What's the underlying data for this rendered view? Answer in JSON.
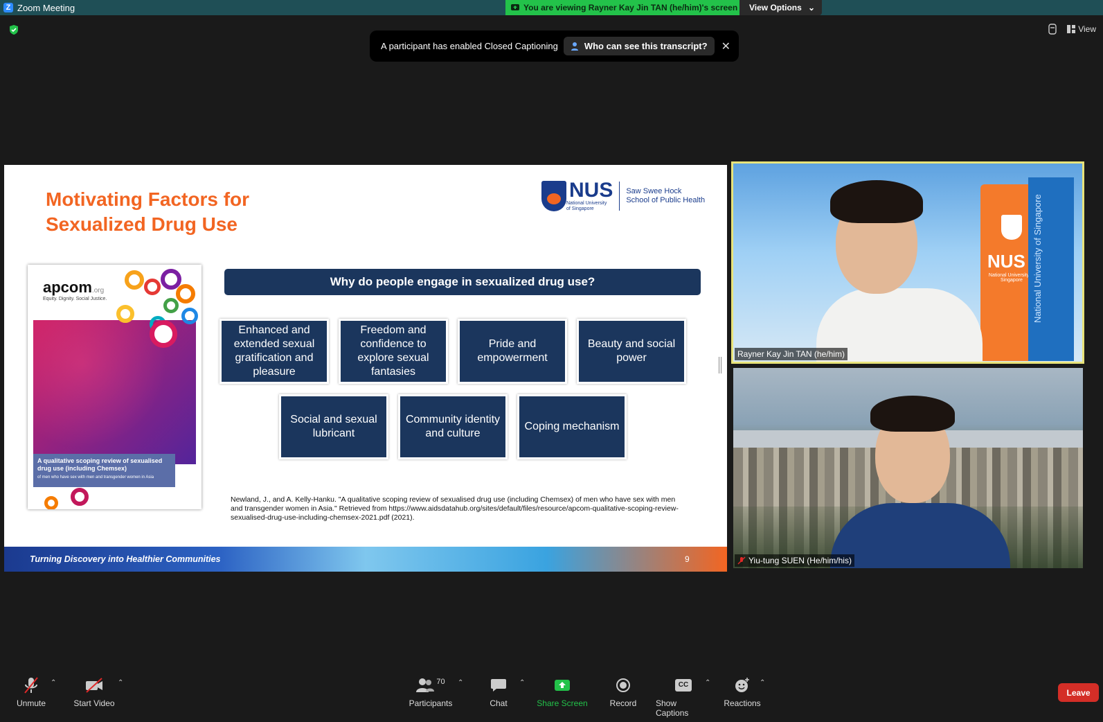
{
  "window": {
    "title": "Zoom Meeting"
  },
  "banner": {
    "viewing_text": "You are viewing Rayner Kay Jin TAN (he/him)'s screen",
    "view_options_label": "View Options"
  },
  "top_right": {
    "view_label": "View"
  },
  "captions_toast": {
    "message": "A participant has enabled Closed Captioning",
    "button_label": "Who can see this transcript?",
    "close_label": "✕"
  },
  "slide": {
    "title_line1": "Motivating Factors for",
    "title_line2": "Sexualized Drug Use",
    "logo": {
      "nus": "NUS",
      "nus_sub1": "National University",
      "nus_sub2": "of Singapore",
      "school_line1": "Saw Swee Hock",
      "school_line2": "School of Public Health"
    },
    "cover": {
      "brand": "apcom",
      "brand_suffix": ".org",
      "tagline": "Equity. Dignity. Social Justice.",
      "band_title_1": "A qualitative scoping review of sexualised",
      "band_title_2": "drug use (including Chemsex)",
      "band_sub": "of men who have sex with men and transgender women in Asia"
    },
    "question": "Why do people engage in sexualized drug use?",
    "factors": [
      "Enhanced and extended sexual gratification and pleasure",
      "Freedom and confidence to explore sexual fantasies",
      "Pride and empowerment",
      "Beauty and social power",
      "Social and sexual lubricant",
      "Community identity and culture",
      "Coping mechanism"
    ],
    "citation_1": "Newland, J., and A. Kelly-Hanku. \"A qualitative scoping review of sexualised drug use (including Chemsex) of men who have sex with men",
    "citation_2": "and transgender women in Asia.\" Retrieved from https://www.aidsdatahub.org/sites/default/files/resource/apcom-qualitative-scoping-review-",
    "citation_3": "sexualised-drug-use-including-chemsex-2021.pdf (2021).",
    "footer_text": "Turning Discovery into Healthier Communities",
    "page_number": "9"
  },
  "participants_video": [
    {
      "name": "Rayner Kay Jin TAN (he/him)",
      "tower_text": "NUS",
      "tower_sub": "National University of Singapore",
      "blue_tower_text": "National University of Singapore"
    },
    {
      "name": "Yiu-tung SUEN (He/him/his)"
    }
  ],
  "toolbar": {
    "unmute": "Unmute",
    "start_video": "Start Video",
    "participants": "Participants",
    "participant_count": "70",
    "chat": "Chat",
    "share_screen": "Share Screen",
    "record": "Record",
    "show_captions": "Show Captions",
    "captions_badge": "CC",
    "reactions": "Reactions",
    "leave": "Leave"
  },
  "colors": {
    "accent_orange": "#f26522",
    "slide_navy": "#1b365d",
    "share_green": "#23c24a",
    "leave_red": "#d42e27",
    "active_speaker": "#e8e37a"
  }
}
